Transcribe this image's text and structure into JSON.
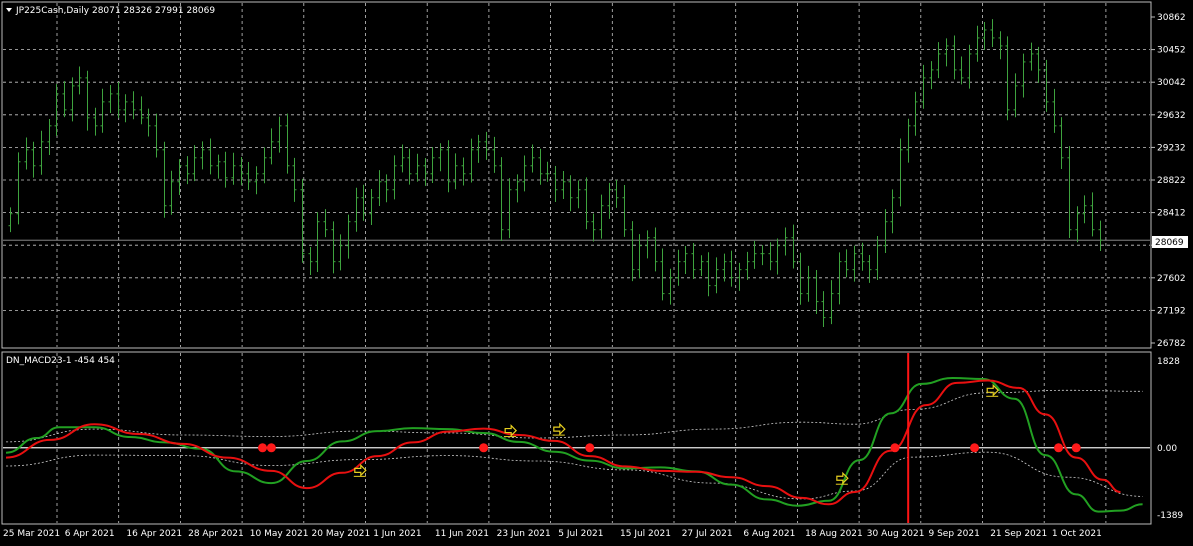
{
  "colors": {
    "background": "#000000",
    "grid": "#c8c8c8",
    "bull": "#3ea33e",
    "green_line": "#22a022",
    "red_line": "#e81010",
    "dot": "#ff1a1a",
    "envelope": "#cfcfcf",
    "vline": "#ff1414",
    "arrow": "#e8d020",
    "text": "#ffffff"
  },
  "header": {
    "symbol": "JP225Cash,Daily",
    "ohlc": "28071 28326 27991 28069"
  },
  "indicator": {
    "title": "DN_MACD23-1 -454 454"
  },
  "price_tag": "28069",
  "chart_data": [
    {
      "type": "ohlc",
      "title": "JP225Cash,Daily",
      "ylim": [
        26782,
        30862
      ],
      "y_ticks": [
        "30862",
        "30452",
        "30042",
        "29632",
        "29232",
        "28822",
        "28412",
        "28002",
        "27602",
        "27192",
        "26782"
      ],
      "x_ticks": [
        "25 Mar 2021",
        "6 Apr 2021",
        "16 Apr 2021",
        "28 Apr 2021",
        "10 May 2021",
        "20 May 2021",
        "1 Jun 2021",
        "11 Jun 2021",
        "23 Jun 2021",
        "5 Jul 2021",
        "15 Jul 2021",
        "27 Jul 2021",
        "6 Aug 2021",
        "18 Aug 2021",
        "30 Aug 2021",
        "9 Sep 2021",
        "21 Sep 2021",
        "1 Oct 2021"
      ],
      "last_price": 28069,
      "closes": [
        28400,
        29050,
        29200,
        29000,
        29300,
        29500,
        29900,
        29700,
        30000,
        30100,
        29600,
        29500,
        29800,
        29900,
        29700,
        29800,
        29700,
        29600,
        29500,
        29200,
        28500,
        28800,
        29000,
        28900,
        29100,
        29200,
        29000,
        29050,
        28850,
        29000,
        28900,
        28800,
        28900,
        29100,
        29300,
        29500,
        29000,
        28700,
        27900,
        27800,
        28300,
        28200,
        27800,
        28000,
        28300,
        28600,
        28400,
        28600,
        28800,
        28700,
        29000,
        29100,
        28900,
        29000,
        28900,
        29100,
        29200,
        28800,
        29000,
        28900,
        29200,
        29300,
        29200,
        29000,
        28200,
        28700,
        28800,
        29000,
        29100,
        28900,
        28900,
        28700,
        28800,
        28600,
        28700,
        28300,
        28200,
        28500,
        28700,
        28600,
        28200,
        27700,
        28000,
        28100,
        27800,
        27400,
        27600,
        27800,
        27900,
        27700,
        27800,
        27500,
        27700,
        27800,
        27600,
        27700,
        27800,
        27900,
        27900,
        27800,
        28000,
        28100,
        27800,
        27400,
        27600,
        27300,
        27100,
        27400,
        27800,
        27700,
        27900,
        27800,
        27700,
        28000,
        28300,
        28600,
        29200,
        29500,
        29800,
        30100,
        30200,
        30400,
        30500,
        30200,
        30100,
        30400,
        30600,
        30700,
        30600,
        30500,
        29700,
        30000,
        30300,
        30400,
        30200,
        29800,
        29500,
        29100,
        28200,
        28400,
        28500,
        28200,
        28069
      ]
    },
    {
      "type": "line",
      "title": "DN_MACD23-1 -454 454",
      "ylim": [
        -1389,
        1828
      ],
      "y_ticks": [
        "1828",
        "0.00",
        "-1389"
      ],
      "x_ticks": [
        "25 Mar 2021",
        "6 Apr 2021",
        "16 Apr 2021",
        "28 Apr 2021",
        "10 May 2021",
        "20 May 2021",
        "1 Jun 2021",
        "11 Jun 2021",
        "23 Jun 2021",
        "5 Jul 2021",
        "15 Jul 2021",
        "27 Jul 2021",
        "6 Aug 2021",
        "18 Aug 2021",
        "30 Aug 2021",
        "9 Sep 2021",
        "21 Sep 2021",
        "1 Oct 2021"
      ],
      "series": [
        {
          "values": [
            [
              0,
              -100
            ],
            [
              7,
              200
            ],
            [
              12,
              420
            ],
            [
              20,
              420
            ],
            [
              28,
              220
            ],
            [
              36,
              110
            ],
            [
              44,
              -20
            ],
            [
              52,
              -480
            ],
            [
              60,
              -720
            ],
            [
              68,
              -270
            ],
            [
              76,
              130
            ],
            [
              84,
              340
            ],
            [
              92,
              400
            ],
            [
              100,
              380
            ],
            [
              108,
              300
            ],
            [
              116,
              120
            ],
            [
              124,
              -80
            ],
            [
              132,
              -260
            ],
            [
              140,
              -420
            ],
            [
              148,
              -400
            ],
            [
              156,
              -480
            ],
            [
              164,
              -750
            ],
            [
              172,
              -1050
            ],
            [
              179,
              -1180
            ],
            [
              186,
              -1080
            ],
            [
              193,
              -250
            ],
            [
              200,
              700
            ],
            [
              207,
              1300
            ],
            [
              214,
              1420
            ],
            [
              221,
              1400
            ],
            [
              228,
              1000
            ],
            [
              235,
              -150
            ],
            [
              242,
              -950
            ],
            [
              247,
              -1300
            ],
            [
              252,
              -1280
            ],
            [
              257,
              -1150
            ]
          ]
        },
        {
          "values": [
            [
              0,
              -200
            ],
            [
              10,
              160
            ],
            [
              20,
              480
            ],
            [
              30,
              280
            ],
            [
              40,
              80
            ],
            [
              50,
              -200
            ],
            [
              60,
              -470
            ],
            [
              68,
              -820
            ],
            [
              76,
              -510
            ],
            [
              84,
              -170
            ],
            [
              92,
              110
            ],
            [
              100,
              330
            ],
            [
              108,
              390
            ],
            [
              116,
              260
            ],
            [
              124,
              140
            ],
            [
              132,
              -170
            ],
            [
              140,
              -380
            ],
            [
              148,
              -470
            ],
            [
              156,
              -490
            ],
            [
              164,
              -600
            ],
            [
              172,
              -780
            ],
            [
              180,
              -1020
            ],
            [
              186,
              -1150
            ],
            [
              192,
              -900
            ],
            [
              200,
              -60
            ],
            [
              208,
              870
            ],
            [
              215,
              1320
            ],
            [
              222,
              1370
            ],
            [
              229,
              1220
            ],
            [
              235,
              680
            ],
            [
              242,
              -200
            ],
            [
              248,
              -650
            ],
            [
              252,
              -900
            ]
          ]
        }
      ],
      "envelope": [
        [
          0,
          -370
        ],
        [
          20,
          -150
        ],
        [
          40,
          -160
        ],
        [
          60,
          -360
        ],
        [
          80,
          -240
        ],
        [
          100,
          -160
        ],
        [
          120,
          -270
        ],
        [
          140,
          -450
        ],
        [
          160,
          -720
        ],
        [
          180,
          -1040
        ],
        [
          192,
          -880
        ],
        [
          205,
          -190
        ],
        [
          222,
          -90
        ],
        [
          240,
          -600
        ],
        [
          257,
          -990
        ]
      ],
      "envelope_upper": [
        [
          0,
          120
        ],
        [
          20,
          380
        ],
        [
          40,
          260
        ],
        [
          60,
          230
        ],
        [
          80,
          340
        ],
        [
          100,
          300
        ],
        [
          120,
          200
        ],
        [
          140,
          260
        ],
        [
          160,
          380
        ],
        [
          180,
          520
        ],
        [
          192,
          480
        ],
        [
          205,
          780
        ],
        [
          222,
          1120
        ],
        [
          240,
          1170
        ],
        [
          257,
          1150
        ]
      ],
      "dots": [
        [
          58,
          0
        ],
        [
          60,
          0
        ],
        [
          108,
          0
        ],
        [
          132,
          0
        ],
        [
          201,
          0
        ],
        [
          219,
          0
        ],
        [
          238,
          0
        ],
        [
          242,
          0
        ]
      ],
      "vline_index": 204
    }
  ]
}
